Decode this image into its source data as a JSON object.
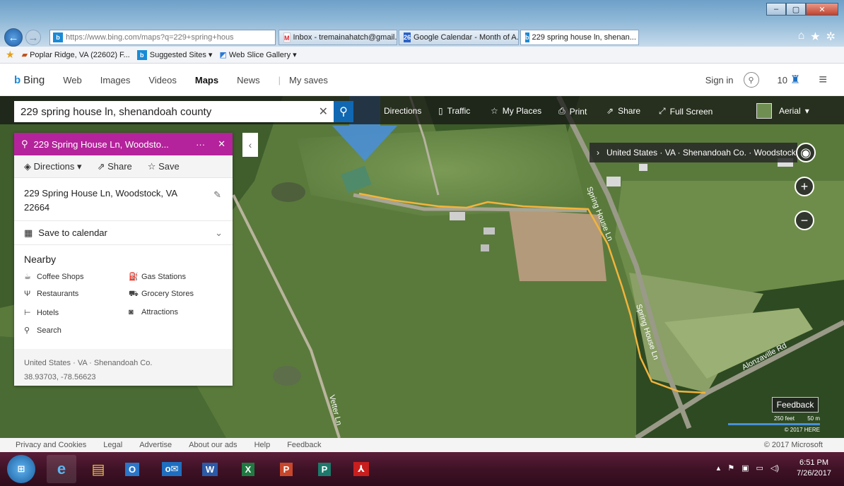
{
  "browser": {
    "address": "https://www.bing.com/maps?q=229+spring+hous",
    "address_host": "www.bing.com",
    "tabs": [
      {
        "label": "Inbox - tremainahatch@gmail....",
        "icon": "gmail-icon"
      },
      {
        "label": "Google Calendar - Month of A...",
        "icon": "calendar-icon"
      },
      {
        "label": "229 spring house ln, shenan...",
        "icon": "bing-icon"
      }
    ],
    "favorites": [
      {
        "label": "Poplar Ridge, VA (22602) F..."
      },
      {
        "label": "Suggested Sites ▾"
      },
      {
        "label": "Web Slice Gallery ▾"
      }
    ]
  },
  "bing": {
    "logo": "Bing",
    "nav": [
      "Web",
      "Images",
      "Videos",
      "Maps",
      "News",
      "My saves"
    ],
    "active_nav": "Maps",
    "sign_in": "Sign in",
    "rewards": "10"
  },
  "map": {
    "search_value": "229 spring house ln, shenandoah county",
    "tools": [
      "Directions",
      "Traffic",
      "My Places",
      "Print",
      "Share",
      "Full Screen"
    ],
    "view_mode": "Aerial",
    "breadcrumb": "United States · VA · Shenandoah Co. · Woodstock",
    "road_labels": [
      "Spring House Ln",
      "Spring House Ln",
      "Alonzaville Rd",
      "Vetter Ln"
    ],
    "scale": {
      "feet": "250 feet",
      "meters": "50 m"
    },
    "map_copyright": "© 2017 HERE",
    "feedback": "Feedback",
    "route_color": "#f2b43c",
    "arrow_color": "#4a8fd6"
  },
  "panel": {
    "title": "229 Spring House Ln, Woodsto...",
    "actions": [
      "Directions",
      "Share",
      "Save"
    ],
    "address_line1": "229 Spring House Ln, Woodstock, VA",
    "address_line2": "22664",
    "save_to_calendar": "Save to calendar",
    "nearby_title": "Nearby",
    "nearby": [
      {
        "label": "Coffee Shops",
        "icon": "coffee-icon"
      },
      {
        "label": "Gas Stations",
        "icon": "gas-icon"
      },
      {
        "label": "Restaurants",
        "icon": "fork-knife-icon"
      },
      {
        "label": "Grocery Stores",
        "icon": "cart-icon"
      },
      {
        "label": "Hotels",
        "icon": "bed-icon"
      },
      {
        "label": "Attractions",
        "icon": "camera-icon"
      },
      {
        "label": "Search",
        "icon": "search-icon"
      }
    ],
    "location": "United States · VA · Shenandoah Co.",
    "coords": "38.93703, -78.56623"
  },
  "footer": {
    "links": [
      "Privacy and Cookies",
      "Legal",
      "Advertise",
      "About our ads",
      "Help",
      "Feedback"
    ],
    "copyright": "© 2017 Microsoft"
  },
  "taskbar": {
    "time": "6:51 PM",
    "date": "7/26/2017"
  }
}
